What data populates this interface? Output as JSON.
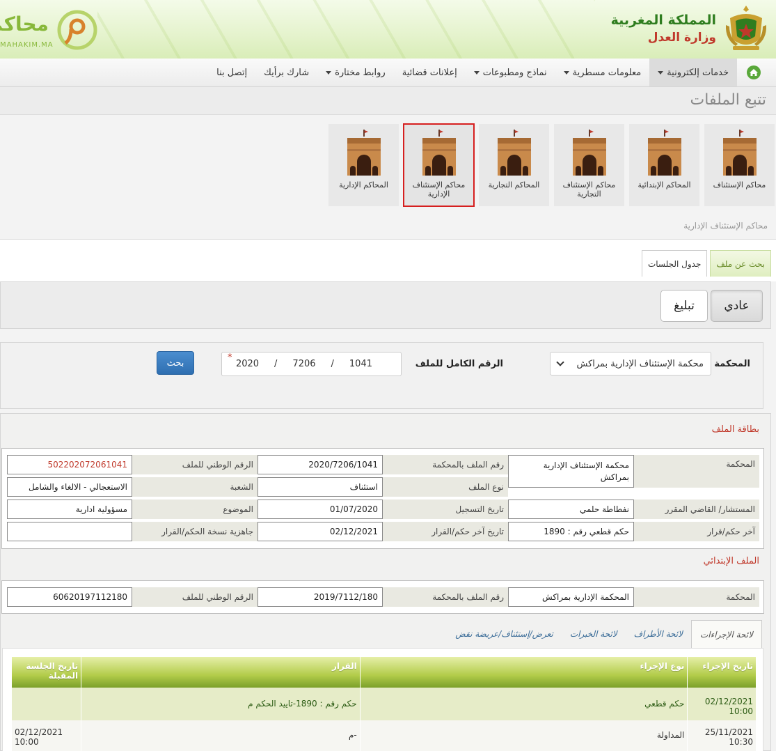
{
  "header": {
    "kingdom": "المملكة المغربية",
    "ministry": "وزارة العدل",
    "logo_ar": "محاكم",
    "logo_en": "MAHAKIM.MA",
    "colors": {
      "green": "#2f7d1f",
      "red": "#c0392b",
      "lime": "#88b83a"
    }
  },
  "nav": {
    "home_icon": "home-icon",
    "items": [
      {
        "label": "خدمات إلكترونية",
        "dropdown": true,
        "active": true
      },
      {
        "label": "معلومات مسطرية",
        "dropdown": true
      },
      {
        "label": "نماذج ومطبوعات",
        "dropdown": true
      },
      {
        "label": "إعلانات قضائية",
        "dropdown": false
      },
      {
        "label": "روابط مختارة",
        "dropdown": true
      },
      {
        "label": "شارك برأيك",
        "dropdown": false
      },
      {
        "label": "إتصل بنا",
        "dropdown": false
      }
    ]
  },
  "page_title": "تتبع الملفات",
  "courts": [
    {
      "label": "محاكم الإستئناف"
    },
    {
      "label": "المحاكم الإبتدائية"
    },
    {
      "label": "محاكم الإستئناف التجارية"
    },
    {
      "label": "المحاكم التجارية"
    },
    {
      "label": "محاكم الإستئناف الإدارية",
      "selected": true
    },
    {
      "label": "المحاكم الإدارية"
    }
  ],
  "selected_court": "محاكم الإستئناف الإدارية",
  "tabs": [
    {
      "label": "بحث عن ملف",
      "active": true
    },
    {
      "label": "جدول الجلسات"
    }
  ],
  "type_toggle": {
    "normal": "عادي",
    "notify": "تبليغ"
  },
  "search": {
    "court_label": "المحكمة",
    "court_value": "محكمة الإستئناف الإدارية بمراكش",
    "file_label": "الرقم الكامل للملف",
    "file_number": "1041",
    "file_code": "7206",
    "file_year": "2020",
    "sep": "/",
    "required": "*",
    "button": "بحث"
  },
  "file_card": {
    "title": "بطاقة الملف",
    "court_label": "المحكمة",
    "court_value": "محكمة الإستئناف الإدارية بمراكش",
    "court_file_label": "رقم الملف بالمحكمة",
    "court_file_value": "2020/7206/1041",
    "national_label": "الرقم الوطني للملف",
    "national_value": "502202072061041",
    "type_label": "نوع الملف",
    "type_value": "استئناف",
    "division_label": "الشعبة",
    "division_value": "الاستعجالي - الالغاء والشامل",
    "judge_label": "المستشار/ القاضي المقرر",
    "judge_value": "نفطاطة حلمي",
    "reg_date_label": "تاريخ التسجيل",
    "reg_date_value": "01/07/2020",
    "subject_label": "الموضوع",
    "subject_value": "مسؤولية ادارية",
    "last_decision_label": "آخر حكم/قرار",
    "last_decision_value": "حكم قطعي رقم : 1890",
    "last_decision_date_label": "تاريخ آخر حكم/القرار",
    "last_decision_date_value": "02/12/2021",
    "copy_ready_label": "جاهزية نسخة الحكم/القرار",
    "copy_ready_value": ""
  },
  "primary_file": {
    "title": "الملف الإبتدائي",
    "court_label": "المحكمة",
    "court_value": "المحكمة الإدارية بمراكش",
    "court_file_label": "رقم الملف بالمحكمة",
    "court_file_value": "2019/7112/180",
    "national_label": "الرقم الوطني للملف",
    "national_value": "60620197112180"
  },
  "proc_tabs": [
    {
      "label": "لائحة الإجراءات",
      "active": true
    },
    {
      "label": "لائحة الأطراف"
    },
    {
      "label": "لائحة الخبرات"
    },
    {
      "label": "تعرض/إستئناف/عريضة نقض"
    }
  ],
  "proc_table": {
    "headers": [
      "تاريخ الإجراء",
      "نوع الإجراء",
      "القرار",
      "تاريخ الجلسة المقبلة"
    ],
    "rows": [
      [
        "02/12/2021 10:00",
        "حكم قطعي",
        "حكم رقم : 1890-تاييد الحكم م",
        ""
      ],
      [
        "25/11/2021 10:30",
        "المداولة",
        "-م",
        "02/12/2021 10:00"
      ]
    ]
  }
}
